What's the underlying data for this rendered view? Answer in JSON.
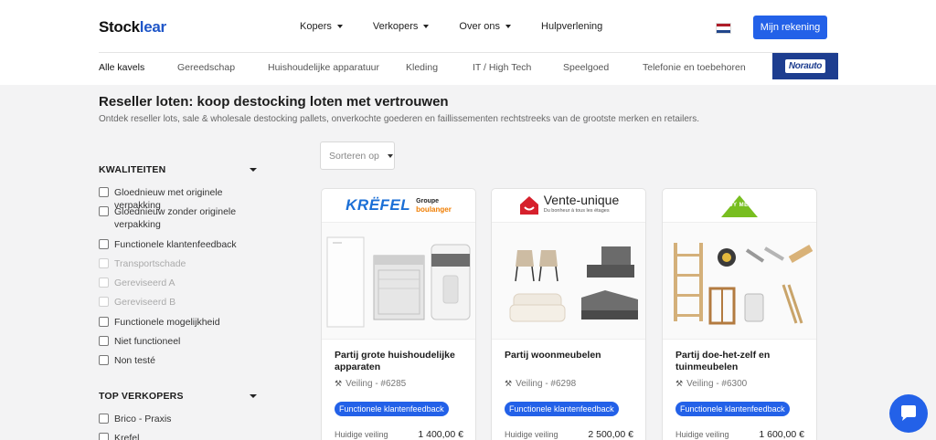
{
  "header": {
    "logo_text": "Stock",
    "logo_accent": "lear",
    "nav": [
      {
        "label": "Kopers",
        "has_dropdown": true
      },
      {
        "label": "Verkopers",
        "has_dropdown": true
      },
      {
        "label": "Over ons",
        "has_dropdown": true
      },
      {
        "label": "Hulpverlening",
        "has_dropdown": false
      }
    ],
    "language_flag": "nl-flag-icon",
    "account_button": "Mijn rekening"
  },
  "categories": [
    {
      "label": "Alle kavels",
      "active": true
    },
    {
      "label": "Gereedschap",
      "active": false
    },
    {
      "label": "Huishoudelijke apparatuur",
      "active": false
    },
    {
      "label": "Kleding",
      "active": false
    },
    {
      "label": "IT / High Tech",
      "active": false
    },
    {
      "label": "Speelgoed",
      "active": false
    },
    {
      "label": "Telefonie en toebehoren",
      "active": false
    }
  ],
  "promo_logo": "Norauto",
  "page": {
    "title": "Reseller loten: koop destocking loten met vertrouwen",
    "subtitle": "Ontdek reseller lots, sale & wholesale destocking pallets, onverkochte goederen en faillissementen rechtstreeks van de grootste merken en retailers."
  },
  "sort": {
    "placeholder": "Sorteren op"
  },
  "filters": {
    "quality": {
      "heading": "KWALITEITEN",
      "options": [
        {
          "label": "Gloednieuw met originele verpakking",
          "enabled": true
        },
        {
          "label": "Gloednieuw zonder originele verpakking",
          "enabled": true
        },
        {
          "label": "Functionele klantenfeedback",
          "enabled": true
        },
        {
          "label": "Transportschade",
          "enabled": false
        },
        {
          "label": "Gereviseerd A",
          "enabled": false
        },
        {
          "label": "Gereviseerd B",
          "enabled": false
        },
        {
          "label": "Functionele mogelijkheid",
          "enabled": true
        },
        {
          "label": "Niet functioneel",
          "enabled": true
        },
        {
          "label": "Non testé",
          "enabled": true
        }
      ]
    },
    "sellers": {
      "heading": "TOP VERKOPERS",
      "options": [
        {
          "label": "Brico - Praxis"
        },
        {
          "label": "Krefel"
        }
      ]
    }
  },
  "lots": [
    {
      "brand": "KREFEL Groupe Boulanger",
      "brand_main": "KRËFEL",
      "brand_sub_top": "Groupe",
      "brand_sub": "boulanger",
      "title": "Partij grote huishoudelijke apparaten",
      "auction": "Veiling - #6285",
      "badge": "Functionele klantenfeedback",
      "price_label": "Huidige veiling",
      "price": "1 400,00 €"
    },
    {
      "brand": "Vente-unique",
      "brand_main": "Vente-unique",
      "brand_sub": "Du bonheur à tous les étages",
      "title": "Partij woonmeubelen",
      "auction": "Veiling - #6298",
      "badge": "Functionele klantenfeedback",
      "price_label": "Huidige veiling",
      "price": "2 500,00 €"
    },
    {
      "brand": "LEROY MERLIN",
      "brand_main": "LEROY MERLIN",
      "title": "Partij doe-het-zelf en tuinmeubelen",
      "auction": "Veiling - #6300",
      "badge": "Functionele klantenfeedback",
      "price_label": "Huidige veiling",
      "price": "1 600,00 €"
    }
  ],
  "colors": {
    "primary": "#2361e8",
    "background": "#f3f3f4",
    "krefel_blue": "#1b6fd6",
    "boulanger_orange": "#f07d00",
    "vente_red": "#d6202c",
    "leroy_green": "#78be20"
  }
}
